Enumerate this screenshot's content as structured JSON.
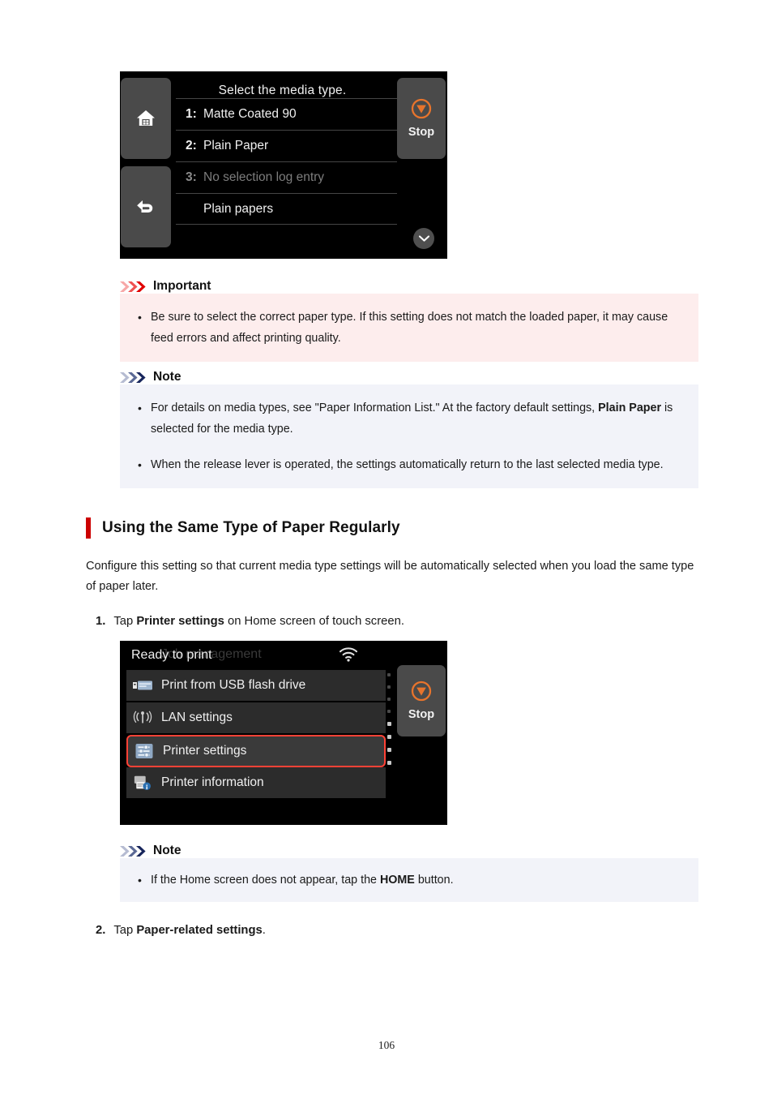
{
  "screen1": {
    "title": "Select the media type.",
    "rows": [
      {
        "num": "1:",
        "label": "Matte Coated 90",
        "dim": false
      },
      {
        "num": "2:",
        "label": "Plain Paper",
        "dim": false
      },
      {
        "num": "3:",
        "label": "No selection log entry",
        "dim": true
      }
    ],
    "group_label": "Plain papers",
    "stop_label": "Stop",
    "icons": {
      "home": "home-icon",
      "back": "back-arrow-icon",
      "stop": "stop-icon",
      "scroll_down": "chevron-down-icon"
    }
  },
  "important": {
    "label": "Important",
    "bullets": [
      "Be sure to select the correct paper type. If this setting does not match the loaded paper, it may cause feed errors and affect printing quality."
    ],
    "accent_color": "#e60000",
    "background": "#fdeded"
  },
  "note1": {
    "label": "Note",
    "bullets": [
      {
        "pre": "For details on media types, see \"Paper Information List.\" At the factory default settings, ",
        "bold": "Plain Paper",
        "post": " is selected for the media type."
      },
      {
        "pre": "When the release lever is operated, the settings automatically return to the last selected media type.",
        "bold": "",
        "post": ""
      }
    ],
    "accent_color": "#1a2b6d",
    "background": "#f2f3f9"
  },
  "section": {
    "title": "Using the Same Type of Paper Regularly",
    "bar_color": "#cc0000",
    "paragraph": "Configure this setting so that current media type settings will be automatically selected when you load the same type of paper later."
  },
  "step1": {
    "number": "1.",
    "pre": "Tap ",
    "bold": "Printer settings",
    "post": " on Home screen of touch screen."
  },
  "screen2": {
    "ghost_title": "Job management",
    "status": "Ready to print",
    "stop_label": "Stop",
    "menu": [
      {
        "label": "Print from USB flash drive",
        "icon": "usb-flash-drive-icon",
        "selected": false
      },
      {
        "label": "LAN settings",
        "icon": "lan-antenna-icon",
        "selected": false
      },
      {
        "label": "Printer settings",
        "icon": "printer-settings-icon",
        "selected": true
      },
      {
        "label": "Printer information",
        "icon": "printer-information-icon",
        "selected": false
      }
    ],
    "icons": {
      "wifi": "wifi-icon",
      "stop": "stop-icon"
    },
    "selection_color": "#ff4236"
  },
  "note2": {
    "label": "Note",
    "bullets": [
      {
        "pre": "If the Home screen does not appear, tap the ",
        "bold": "HOME",
        "post": " button."
      }
    ],
    "accent_color": "#1a2b6d",
    "background": "#f2f3f9"
  },
  "step2": {
    "number": "2.",
    "pre": "Tap ",
    "bold": "Paper-related settings",
    "post": "."
  },
  "footer": {
    "page_number": "106"
  }
}
